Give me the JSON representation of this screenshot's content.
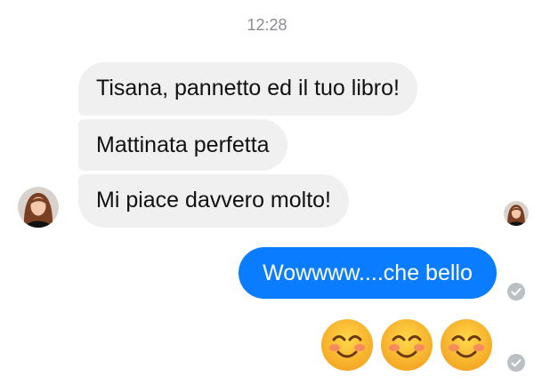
{
  "thread": {
    "timestamp": "12:28",
    "incoming": [
      {
        "text": "Tisana, pannetto ed il tuo libro!"
      },
      {
        "text": "Mattinata perfetta"
      },
      {
        "text": "Mi piace davvero molto!"
      }
    ],
    "outgoing": [
      {
        "text": "Wowwww....che bello"
      }
    ],
    "emojis": [
      "smiling-face-with-smiling-eyes-emoji",
      "smiling-face-with-smiling-eyes-emoji",
      "smiling-face-with-smiling-eyes-emoji"
    ],
    "colors": {
      "incoming_bubble": "#f1f0f0",
      "outgoing_bubble": "#0a7cff",
      "timestamp_text": "#8a8d91",
      "check": "#bcc0c4"
    }
  }
}
